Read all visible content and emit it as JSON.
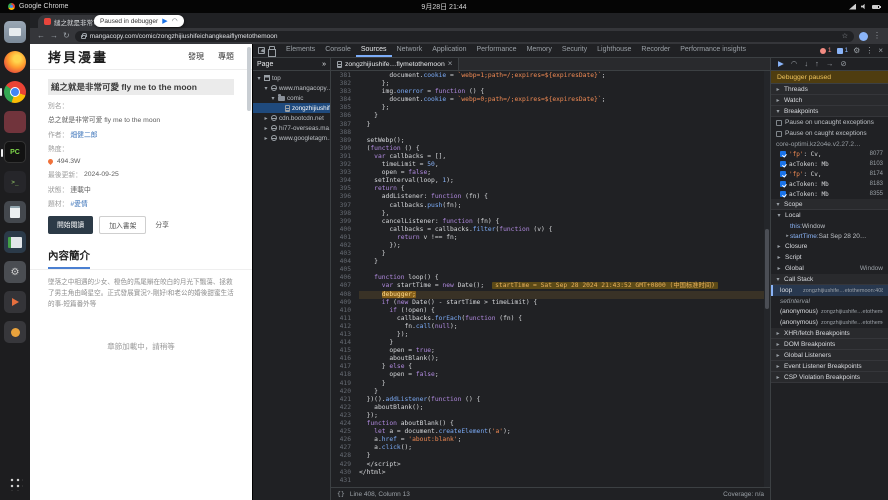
{
  "system_bar": {
    "app_name": "Google Chrome",
    "clock": "9月28日 21:44"
  },
  "dock": {
    "icons": [
      {
        "type": "files"
      },
      {
        "type": "firefox"
      },
      {
        "type": "chrome",
        "running": true
      },
      {
        "type": "gimp"
      },
      {
        "type": "pycharm",
        "text": "PC",
        "running": true
      },
      {
        "type": "terminal",
        "text": ">_"
      },
      {
        "type": "texteditor"
      },
      {
        "type": "office"
      },
      {
        "type": "settings",
        "text": "⚙"
      },
      {
        "type": "media"
      },
      {
        "type": "store"
      }
    ]
  },
  "browser": {
    "tab_title": "縋之就是非常可愛 fly me t...",
    "url": "mangacopy.com/comic/zongzhijiushifeichangkeaiflymetothemoon",
    "paused_badge": "Paused in debugger"
  },
  "page": {
    "logo": "拷貝漫畫",
    "nav": [
      "發現",
      "專題"
    ],
    "title": "縋之就是非常可愛 fly me to the moon",
    "info_rows": [
      {
        "label": "別名："
      },
      {
        "value": "总之就是非常可爱 fly me to the moon"
      },
      {
        "label": "作者：",
        "value": "畑健二郎",
        "accent": true
      },
      {
        "label": "熱度："
      },
      {
        "value": "494.3W",
        "icon": "flame-icon"
      },
      {
        "label": "最後更新：",
        "value": "2024-09-25"
      },
      {
        "label": "狀態：",
        "value": "連載中"
      },
      {
        "label": "題材：",
        "value": "#愛情",
        "accent": true
      }
    ],
    "buttons": [
      "開始閱讀",
      "加入書架",
      "分享"
    ],
    "section_title": "內容簡介",
    "synopsis": "墜落之中相遇的少女、橙色的馬尾辮在皎白的月光下飄蕩、拯救了男主角由崎星空。正式發展實況?-剛好!和老公的婚後甜蜜生活的事-短篇番外等",
    "loading": "章節加載中，請稍等"
  },
  "devtools": {
    "toolbar": {
      "tabs": [
        "Elements",
        "Console",
        "Sources",
        "Network",
        "Application",
        "Performance",
        "Memory",
        "Security",
        "Lighthouse",
        "Recorder",
        "Performance insights"
      ],
      "active_tab": "Sources",
      "error_count": "1",
      "issue_count": "1"
    },
    "files": {
      "panel_tab": "Page",
      "tree": [
        {
          "label": "top",
          "depth": 0,
          "icon": "frame-icon",
          "expanded": true
        },
        {
          "label": "www.mangacopy…",
          "depth": 1,
          "icon": "globe-icon",
          "expanded": true
        },
        {
          "label": "comic",
          "depth": 2,
          "icon": "folder-icon",
          "expanded": true
        },
        {
          "label": "zongzhijiushif…",
          "depth": 3,
          "icon": "file-icon",
          "selected": true
        },
        {
          "label": "cdn.bootcdn.net",
          "depth": 1,
          "icon": "globe-icon",
          "expanded": false
        },
        {
          "label": "hi77-overseas.ma…",
          "depth": 1,
          "icon": "globe-icon",
          "expanded": false
        },
        {
          "label": "www.googletagm…",
          "depth": 1,
          "icon": "globe-icon",
          "expanded": false
        }
      ]
    },
    "editor": {
      "tab_title": "zongzhijiushife…flymetothemoon",
      "first_line": 381,
      "paused_line": 408,
      "inline_eval_line": 407,
      "inline_eval": "startTime = Sat Sep 28 2024 21:43:52 GMT+0800 (中国标准时间)",
      "lines": [
        "        document.cookie = `webp=1;path=/;expires=${expiresDate}`;",
        "      };",
        "      img.onerror = function () {",
        "        document.cookie = `webp=0;path=/;expires=${expiresDate}`;",
        "      };",
        "    }",
        "  }",
        "",
        "  setWebp();",
        "  (function () {",
        "    var callbacks = [],",
        "      timeLimit = 50,",
        "      open = false;",
        "    setInterval(loop, 1);",
        "    return {",
        "      addListener: function (fn) {",
        "        callbacks.push(fn);",
        "      },",
        "      cancelListener: function (fn) {",
        "        callbacks = callbacks.filter(function (v) {",
        "          return v !== fn;",
        "        });",
        "      }",
        "    }",
        "",
        "    function loop() {",
        "      var startTime = new Date();",
        "      debugger;",
        "      if (new Date() - startTime > timeLimit) {",
        "        if (!open) {",
        "          callbacks.forEach(function (fn) {",
        "            fn.call(null);",
        "          });",
        "        }",
        "        open = true;",
        "        aboutBlank();",
        "      } else {",
        "        open = false;",
        "      }",
        "    }",
        "  })().addListener(function () {",
        "    aboutBlank();",
        "  });",
        "  function aboutBlank() {",
        "    let a = document.createElement('a');",
        "    a.href = 'about:blank';",
        "    a.click();",
        "  }",
        "  </script>",
        "</html>",
        ""
      ]
    },
    "debugger": {
      "paused_banner": "Debugger paused",
      "collapsed_top": [
        "Threads",
        "Watch"
      ],
      "breakpoints": {
        "title": "Breakpoints",
        "pause_uncaught": "Pause on uncaught exceptions",
        "pause_caught": "Pause on caught exceptions",
        "group": "core-optimi.kz2o4e.v2.27.2…",
        "entries": [
          {
            "code": "'fp': Cv,",
            "line": "8077",
            "checked": true
          },
          {
            "code": "acToken: Mb",
            "line": "8103",
            "checked": true
          },
          {
            "code": "'fp': Cv,",
            "line": "8174",
            "checked": true
          },
          {
            "code": "acToken: Mb",
            "line": "8183",
            "checked": true
          },
          {
            "code": "acToken: Mb",
            "line": "8355",
            "checked": true
          }
        ]
      },
      "scope": {
        "title": "Scope",
        "groups": [
          {
            "name": "Local",
            "expanded": true,
            "vars": [
              {
                "name": "this",
                "value": "Window"
              },
              {
                "name": "startTime",
                "value": "Sat Sep 28 20…",
                "expandable": true
              }
            ]
          },
          {
            "name": "Closure"
          },
          {
            "name": "Script"
          },
          {
            "name": "Global",
            "value": "Window"
          }
        ]
      },
      "call_stack": {
        "title": "Call Stack",
        "frames": [
          {
            "name": "loop",
            "location": "zongzhijiushife…etothemoon:408",
            "active": true
          },
          {
            "name": "setInterval",
            "separator": true
          },
          {
            "name": "(anonymous)",
            "location": "zongzhijiushife…etothemoon"
          },
          {
            "name": "(anonymous)",
            "location": "zongzhijiushife…etothemoon"
          }
        ]
      },
      "collapsed_bottom": [
        "XHR/fetch Breakpoints",
        "DOM Breakpoints",
        "Global Listeners",
        "Event Listener Breakpoints",
        "CSP Violation Breakpoints"
      ]
    },
    "status_bar": {
      "position": "Line 408, Column 13",
      "coverage": "Coverage: n/a"
    }
  },
  "glyphs": {
    "back": "←",
    "forward": "→",
    "reload": "↻",
    "star": "☆",
    "kebab": "⋮",
    "gear": "⚙",
    "close": "×",
    "plus": "+",
    "resume": "▶",
    "step_over": "◠",
    "step_into": "↓",
    "step_out": "↑",
    "step": "→",
    "deactivate": "⊘",
    "pretty_print": "{}",
    "chev_right": "▸",
    "chev_down": "▾",
    "overflow": "»"
  },
  "colors": {
    "devtools_accent": "#8ab4f8",
    "paused_amber": "#f2c55c",
    "error_red": "#f28b82",
    "link_blue": "#3b73b9",
    "primary_button": "#2c3a47",
    "section_underline": "#4a7fd1"
  }
}
